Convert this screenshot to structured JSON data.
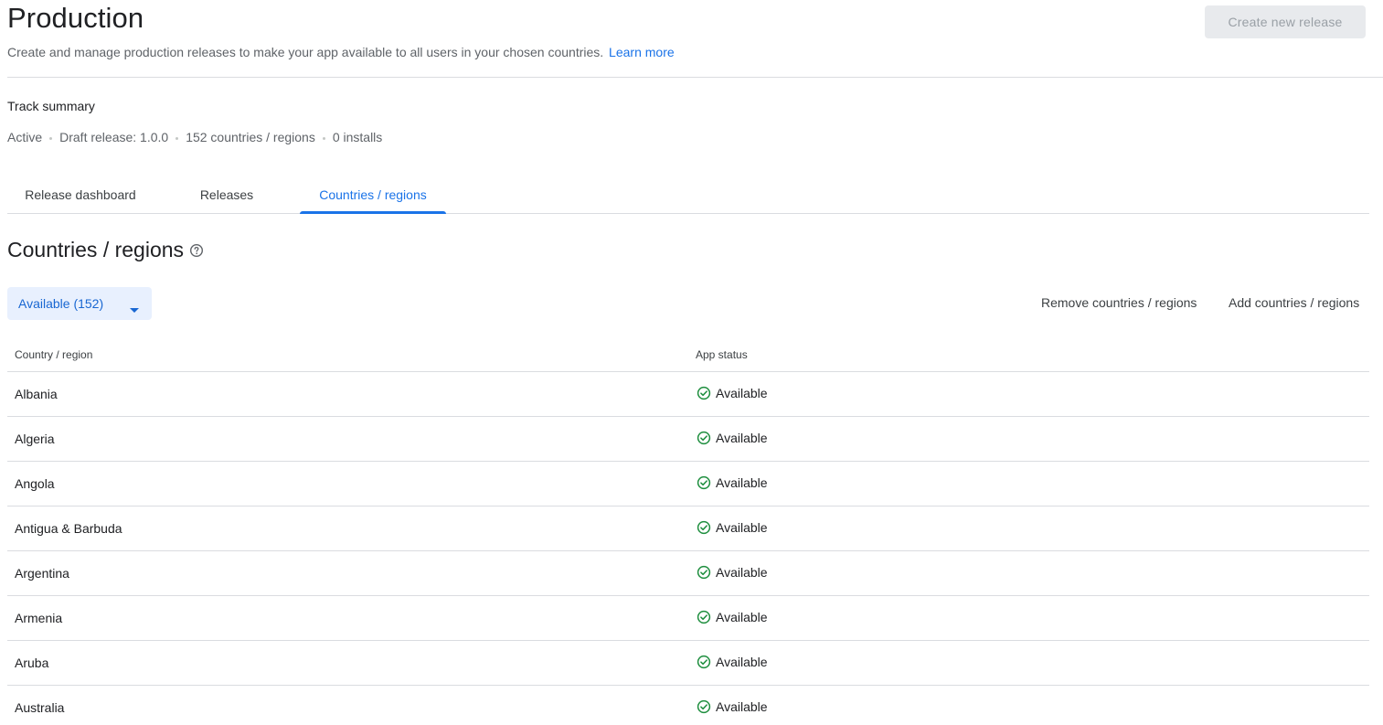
{
  "header": {
    "title": "Production",
    "subtitle": "Create and manage production releases to make your app available to all users in your chosen countries.",
    "learn_more": "Learn more",
    "create_button": "Create new release"
  },
  "track_summary": {
    "label": "Track summary",
    "status": "Active",
    "draft_release": "Draft release: 1.0.0",
    "countries": "152 countries / regions",
    "installs": "0 installs"
  },
  "tabs": [
    {
      "label": "Release dashboard",
      "active": false
    },
    {
      "label": "Releases",
      "active": false
    },
    {
      "label": "Countries / regions",
      "active": true
    }
  ],
  "section": {
    "title": "Countries / regions",
    "filter_label": "Available (152)",
    "remove_action": "Remove countries / regions",
    "add_action": "Add countries / regions"
  },
  "table": {
    "columns": [
      "Country / region",
      "App status"
    ],
    "rows": [
      {
        "country": "Albania",
        "status": "Available"
      },
      {
        "country": "Algeria",
        "status": "Available"
      },
      {
        "country": "Angola",
        "status": "Available"
      },
      {
        "country": "Antigua & Barbuda",
        "status": "Available"
      },
      {
        "country": "Argentina",
        "status": "Available"
      },
      {
        "country": "Armenia",
        "status": "Available"
      },
      {
        "country": "Aruba",
        "status": "Available"
      },
      {
        "country": "Australia",
        "status": "Available"
      }
    ]
  },
  "colors": {
    "accent": "#1a73e8",
    "available_green": "#1e8e3e",
    "chip_bg": "#e8f0fe",
    "disabled_button_bg": "#e8eaed"
  },
  "icons": {
    "help": "help-circle-icon",
    "caret": "caret-down-icon",
    "status": "check-circle-icon"
  }
}
